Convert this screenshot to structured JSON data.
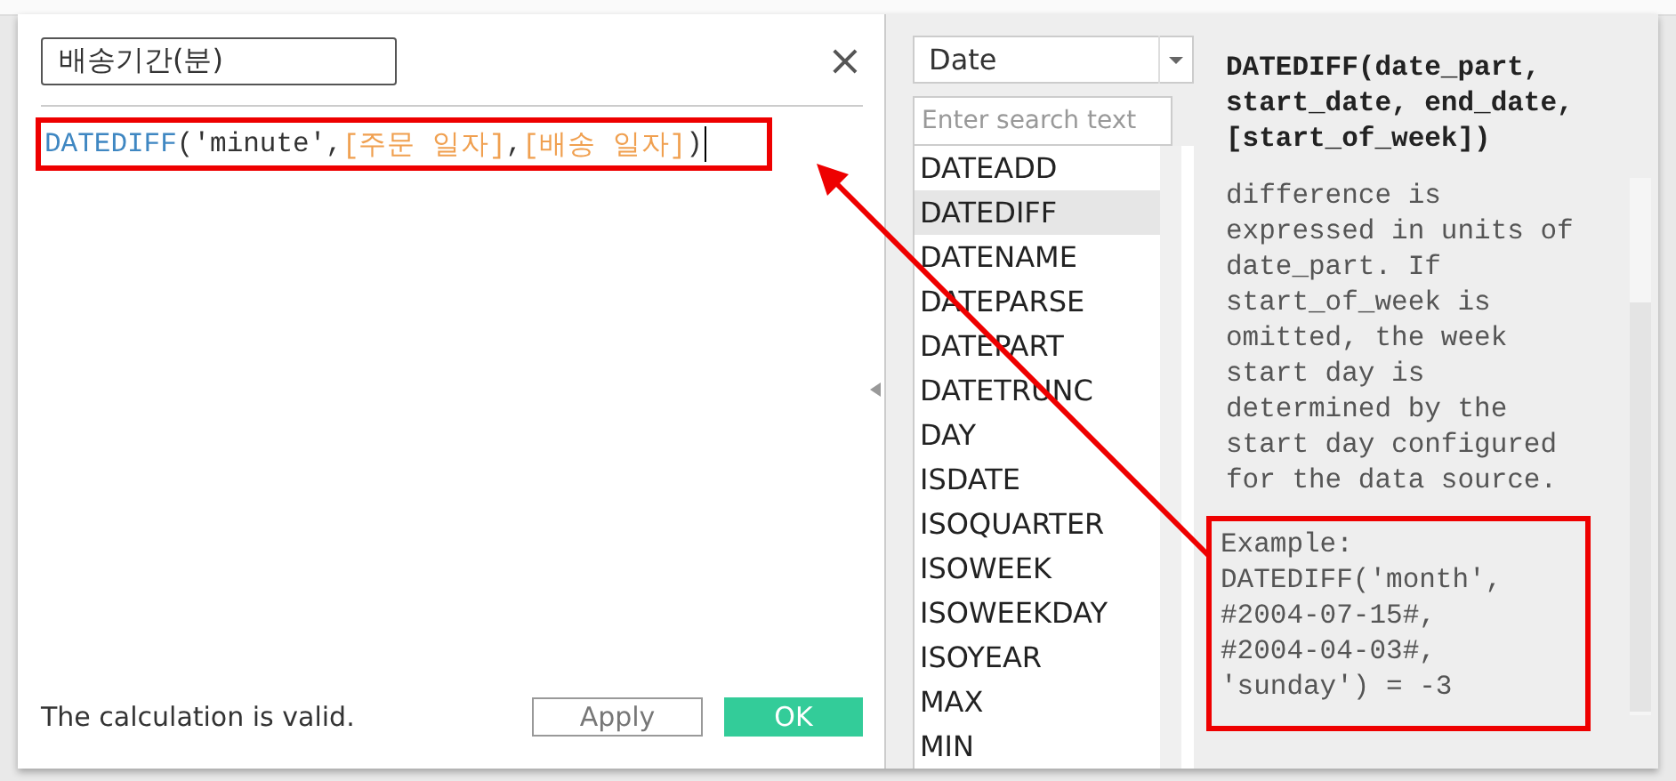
{
  "dialog": {
    "name_field": {
      "value": "배송기간(분)"
    },
    "close": "×",
    "formula": [
      {
        "kind": "function",
        "text": "DATEDIFF"
      },
      {
        "kind": "plain",
        "text": "('minute',"
      },
      {
        "kind": "field",
        "text": "[주문 일자]"
      },
      {
        "kind": "plain",
        "text": ","
      },
      {
        "kind": "field",
        "text": "[배송 일자]"
      },
      {
        "kind": "plain",
        "text": ")"
      }
    ],
    "status": "The calculation is valid.",
    "buttons": [
      {
        "label": "Apply",
        "kind": "secondary"
      },
      {
        "label": "OK",
        "kind": "primary"
      }
    ]
  },
  "functions": {
    "category": "Date",
    "search": {
      "placeholder": "Enter search text"
    },
    "items": [
      {
        "label": "DATEADD",
        "selected": false
      },
      {
        "label": "DATEDIFF",
        "selected": true
      },
      {
        "label": "DATENAME",
        "selected": false
      },
      {
        "label": "DATEPARSE",
        "selected": false
      },
      {
        "label": "DATEPART",
        "selected": false
      },
      {
        "label": "DATETRUNC",
        "selected": false
      },
      {
        "label": "DAY",
        "selected": false
      },
      {
        "label": "ISDATE",
        "selected": false
      },
      {
        "label": "ISOQUARTER",
        "selected": false
      },
      {
        "label": "ISOWEEK",
        "selected": false
      },
      {
        "label": "ISOWEEKDAY",
        "selected": false
      },
      {
        "label": "ISOYEAR",
        "selected": false
      },
      {
        "label": "MAX",
        "selected": false
      },
      {
        "label": "MIN",
        "selected": false
      }
    ]
  },
  "help": {
    "signature": "DATEDIFF(date_part,\nstart_date, end_date,\n[start_of_week])",
    "description": "difference is\nexpressed in units of\ndate_part. If\nstart_of_week is\nomitted, the week\nstart day is\ndetermined by the\nstart day configured\nfor the data source.",
    "example": "Example:\nDATEDIFF('month',\n#2004-07-15#,\n#2004-04-03#,\n'sunday') = -3"
  }
}
